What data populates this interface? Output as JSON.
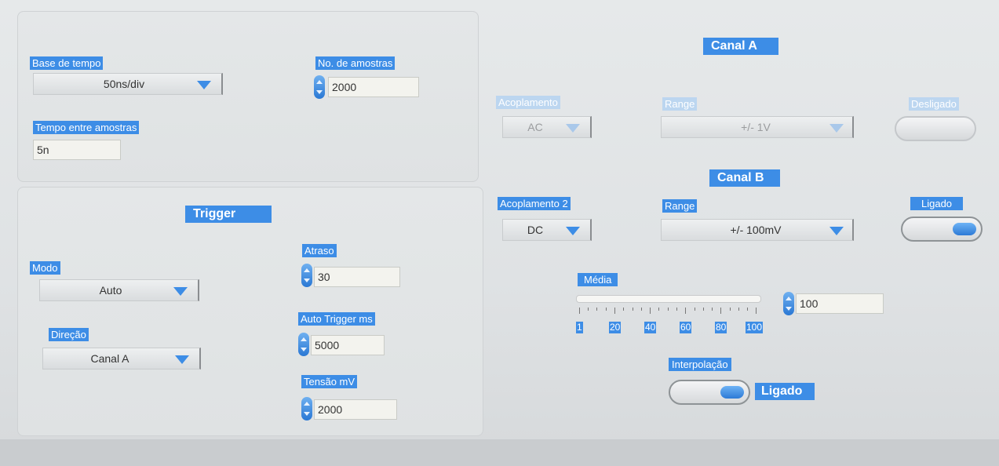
{
  "left_panel": {
    "base_tempo": {
      "label": "Base de tempo",
      "value": "50ns/div"
    },
    "num_amostras": {
      "label": "No. de amostras",
      "value": "2000"
    },
    "tempo_entre": {
      "label": "Tempo entre amostras",
      "value": "5n"
    }
  },
  "trigger": {
    "title": "Trigger",
    "modo": {
      "label": "Modo",
      "value": "Auto"
    },
    "direcao": {
      "label": "Direção",
      "value": "Canal A"
    },
    "atraso": {
      "label": "Atraso",
      "value": "30"
    },
    "auto_trigger": {
      "label": "Auto Trigger ms",
      "value": "5000"
    },
    "tensao": {
      "label": "Tensão mV",
      "value": "2000"
    }
  },
  "canal_a": {
    "title": "Canal A",
    "acoplamento": {
      "label": "Acoplamento",
      "value": "AC"
    },
    "range": {
      "label": "Range",
      "value": "+/- 1V"
    },
    "state_label": "Desligado"
  },
  "canal_b": {
    "title": "Canal B",
    "acoplamento": {
      "label": "Acoplamento 2",
      "value": "DC"
    },
    "range": {
      "label": "Range",
      "value": "+/- 100mV"
    },
    "state_label": "Ligado"
  },
  "media": {
    "label": "Média",
    "ticks": [
      "1",
      "20",
      "40",
      "60",
      "80",
      "100"
    ],
    "value": "100"
  },
  "interpolacao": {
    "label": "Interpolação",
    "state_label": "Ligado"
  },
  "colors": {
    "accent": "#3d8de6",
    "background": "#e2e5e6"
  }
}
